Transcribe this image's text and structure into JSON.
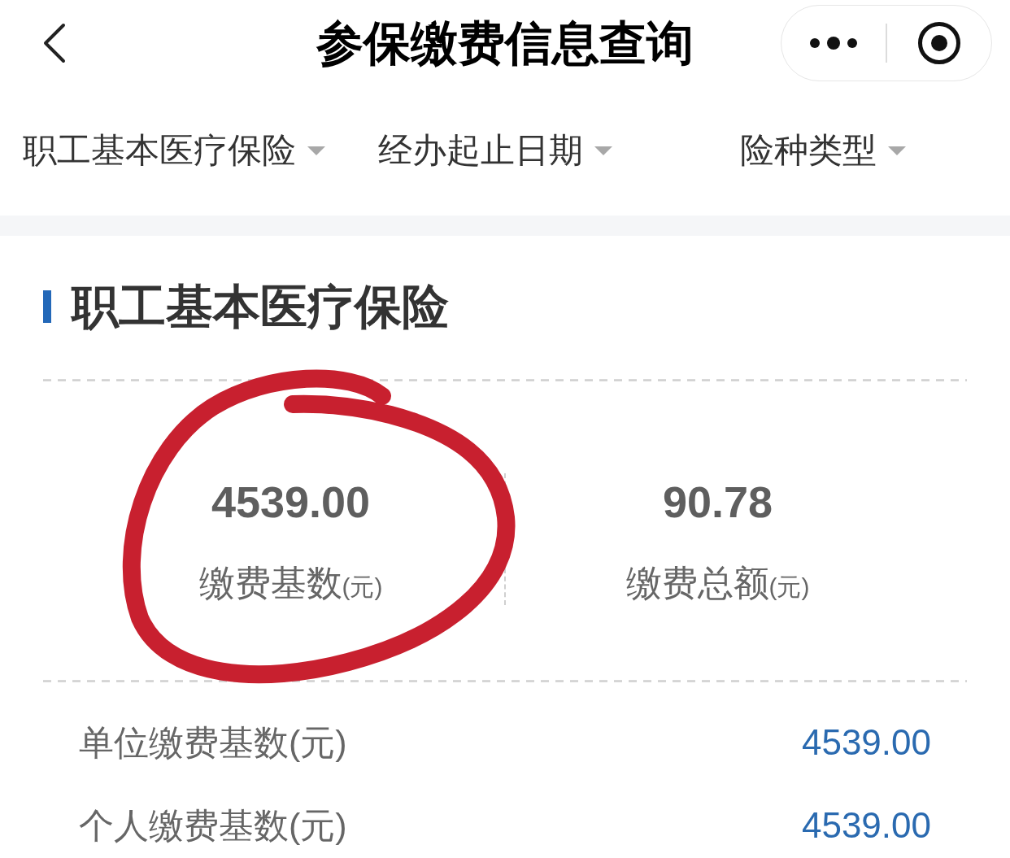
{
  "nav": {
    "title": "参保缴费信息查询"
  },
  "filters": [
    {
      "label": "职工基本医疗保险"
    },
    {
      "label": "经办起止日期"
    },
    {
      "label": "险种类型"
    }
  ],
  "section": {
    "title": "职工基本医疗保险",
    "stats": [
      {
        "value": "4539.00",
        "label": "缴费基数",
        "unit": "(元)"
      },
      {
        "value": "90.78",
        "label": "缴费总额",
        "unit": "(元)"
      }
    ],
    "rows": [
      {
        "label": "单位缴费基数(元)",
        "value": "4539.00"
      },
      {
        "label": "个人缴费基数(元)",
        "value": "4539.00"
      }
    ]
  },
  "annotation": {
    "kind": "circle"
  }
}
